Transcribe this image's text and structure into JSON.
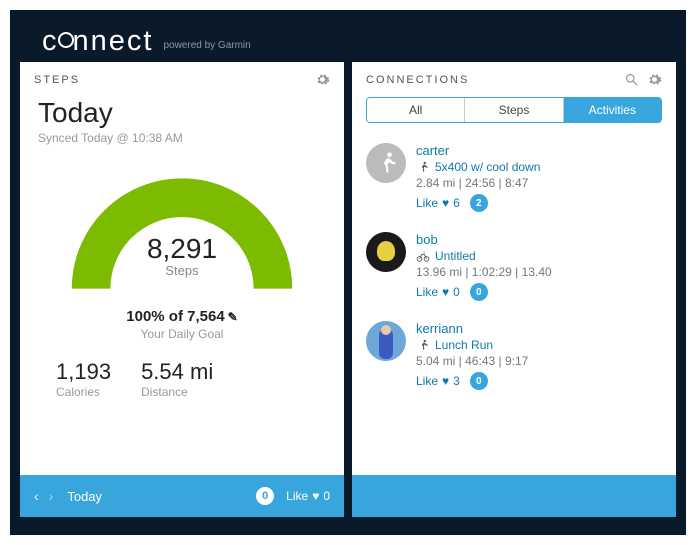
{
  "brand": {
    "name_prefix": "c",
    "name_suffix": "nnect",
    "powered": "powered by Garmin"
  },
  "steps_panel": {
    "title": "STEPS",
    "heading": "Today",
    "synced": "Synced Today @ 10:38 AM",
    "count": "8,291",
    "count_label": "Steps",
    "goal_line": "100% of 7,564",
    "goal_sub": "Your Daily Goal",
    "calories": {
      "value": "1,193",
      "label": "Calories"
    },
    "distance": {
      "value": "5.54 mi",
      "label": "Distance"
    },
    "footer": {
      "label": "Today",
      "comments": "0",
      "like_label": "Like",
      "likes": "0"
    }
  },
  "connections_panel": {
    "title": "CONNECTIONS",
    "tabs": [
      {
        "label": "All"
      },
      {
        "label": "Steps"
      },
      {
        "label": "Activities"
      }
    ],
    "active_tab": 2,
    "items": [
      {
        "user": "carter",
        "activity": "5x400 w/ cool down",
        "type": "run",
        "stats": "2.84 mi | 24:56 | 8:47",
        "likes": "6",
        "comments": "2"
      },
      {
        "user": "bob",
        "activity": "Untitled",
        "type": "bike",
        "stats": "13.96 mi | 1:02:29 | 13.40",
        "likes": "0",
        "comments": "0"
      },
      {
        "user": "kerriann",
        "activity": "Lunch Run",
        "type": "run",
        "stats": "5.04 mi | 46:43 | 9:17",
        "likes": "3",
        "comments": "0"
      }
    ],
    "like_label": "Like"
  },
  "colors": {
    "accent": "#38a6dc",
    "gauge": "#7cbb00"
  }
}
